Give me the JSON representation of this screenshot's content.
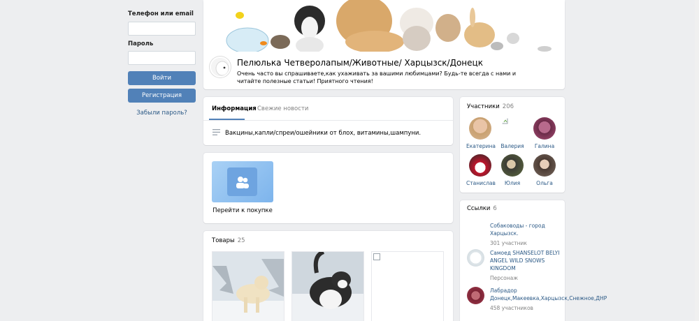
{
  "login": {
    "phone_label": "Телефон или email",
    "password_label": "Пароль",
    "login_button": "Войти",
    "register_button": "Регистрация",
    "forgot_link": "Забыли пароль?"
  },
  "group": {
    "title": "Пелюлька Четверолапым/Животные/ Харцызск/Донецк",
    "status": "Очень часто вы спрашиваете,как ухаживать за вашими любимцами? Будь-те всегда с нами и читайте полезные статьи! Приятного чтения!"
  },
  "tabs": [
    {
      "label": "Информация",
      "active": true
    },
    {
      "label": "Свежие новости",
      "active": false
    }
  ],
  "info": {
    "description": "Вакцины,капли/спреи/ошейники от блох, витамины,шампуни."
  },
  "buy": {
    "label": "Перейти к покупке"
  },
  "goods": {
    "title": "Товары",
    "count": "25"
  },
  "members": {
    "title": "Участники",
    "count": "206",
    "list": [
      "Екатерина",
      "Валерия",
      "Галина",
      "Станислав",
      "Юлия",
      "Ольга"
    ]
  },
  "links": {
    "title": "Ссылки",
    "count": "6",
    "items": [
      {
        "title": "Собаководы - город Харцызск.",
        "sub": "301 участник"
      },
      {
        "title": "Самоед SHANSELOT BELYI ANGEL WILD SNOWS KINGDOM",
        "sub": "Персонаж"
      },
      {
        "title": "Лабрадор Донецк,Макеевка,Харцызск,Снежное,ДНР",
        "sub": "458 участников"
      }
    ]
  },
  "colors": {
    "accent": "#5181b8",
    "link": "#2a5885",
    "background": "#edeef0"
  }
}
